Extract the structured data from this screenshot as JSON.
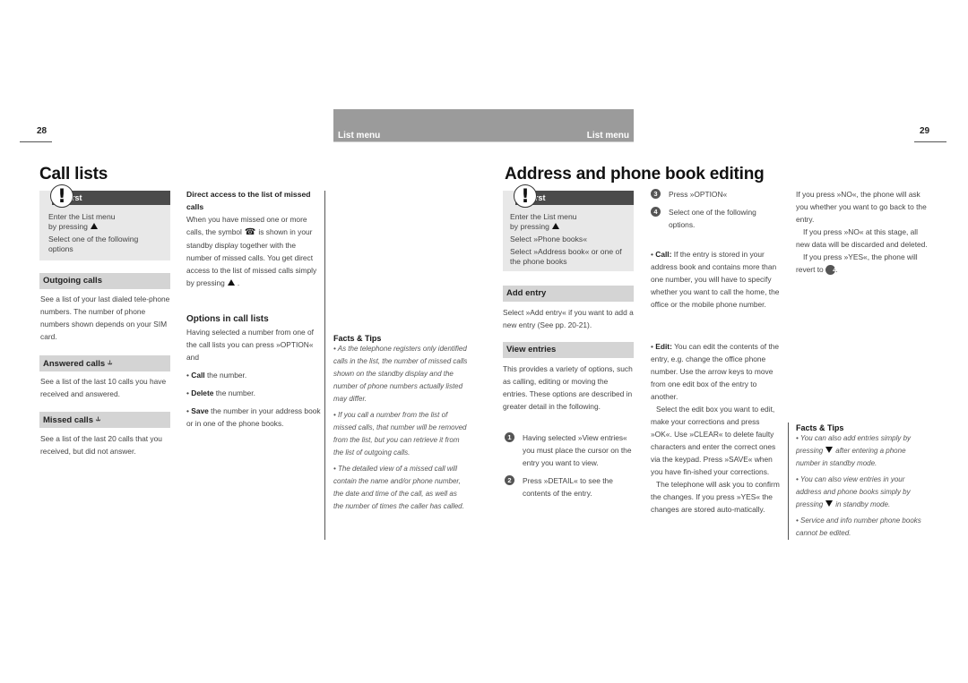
{
  "header": {
    "left_page_number": "28",
    "right_page_number": "29",
    "left_section_label": "List menu",
    "right_section_label": "List menu"
  },
  "left_page": {
    "title": "Call lists",
    "first_box": {
      "label": "First",
      "line1": "Enter the List menu",
      "line2": "by pressing",
      "line3": "Select one of the following options"
    },
    "outgoing": {
      "heading": "Outgoing calls",
      "text": "See a list of your last dialed tele-phone numbers. The number of phone numbers shown depends on your SIM card."
    },
    "answered": {
      "heading": "Answered calls",
      "text": "See a list of the last 10 calls you have received and answered."
    },
    "missed": {
      "heading": "Missed calls",
      "text": "See a list of the last 20 calls that you received, but did not answer."
    },
    "direct_access": {
      "heading": "Direct access to the list of missed calls",
      "text_before_symbol": "When you have missed one or more calls, the symbol",
      "text_after_symbol": "is shown in your standby display together with the number of missed calls. You get direct access to the list of missed calls simply by pressing"
    },
    "options": {
      "heading": "Options in call lists",
      "intro": "Having selected a number from one of the call lists you can press »OPTION« and",
      "items": [
        {
          "bold": "Call",
          "rest": "the number."
        },
        {
          "bold": "Delete",
          "rest": "the number."
        },
        {
          "bold": "Save",
          "rest": "the number in your address book or in one of the phone books."
        }
      ]
    },
    "tips": {
      "heading": "Facts & Tips",
      "items": [
        "• As the telephone registers only identified calls in the list, the number of missed calls shown on the standby display and the number of phone numbers actually listed may differ.",
        "• If you call a number from the list of missed calls, that number will be removed from the list, but you can retrieve it from the list of outgoing calls.",
        "• The detailed view of a missed call will contain the name and/or phone number, the date and time of the call, as well as the number of times the caller has called."
      ]
    }
  },
  "right_page": {
    "title": "Address and phone book editing",
    "first_box": {
      "label": "First",
      "line1": "Enter the List menu",
      "line2": "by pressing",
      "line3": "Select »Phone books«",
      "line4": "Select »Address book« or one of the phone books"
    },
    "add_entry": {
      "heading": "Add entry",
      "text": "Select »Add entry« if you want to add a new entry (See pp. 20-21)."
    },
    "view_entries": {
      "heading": "View entries",
      "text": "This provides a variety of options, such as calling, editing or moving the entries. These options are described in greater detail in the following.",
      "steps": [
        {
          "num": "1",
          "text": "Having selected »View entries« you must place the cursor on the entry you want to view."
        },
        {
          "num": "2",
          "text": "Press »DETAIL« to see the contents of the entry."
        }
      ]
    },
    "steps_col2": [
      {
        "num": "3",
        "text": "Press »OPTION«"
      },
      {
        "num": "4",
        "text": "Select one of the following options."
      }
    ],
    "call_item": {
      "bold": "Call:",
      "text": "If the entry is stored in your address book and contains more than one number, you will have to specify whether you want to call the home, the office or the mobile phone number."
    },
    "edit_item": {
      "bold": "Edit:",
      "text": "You can edit the contents of the entry, e.g. change the office phone number. Use the arrow keys to move from one edit box of the entry to another.",
      "para2": "Select the edit box you want to edit, make your corrections and press »OK«. Use »CLEAR« to delete faulty characters and enter the correct ones via the keypad. Press »SAVE« when you have fin-ished your corrections.",
      "para3": "The telephone will ask you to confirm the changes. If you press »YES« the changes are stored auto-matically."
    },
    "col3": {
      "para1": "If you press »NO«, the phone will ask you whether you want to go back to the entry.",
      "para2": "If you press »NO« at this stage, all new data will be discarded and deleted.",
      "para3": "If you press »YES«, the phone will revert to",
      "revert_num": "4"
    },
    "tips": {
      "heading": "Facts & Tips",
      "item1_before": "• You can also add entries simply by pressing",
      "item1_after": "after entering a phone number in standby mode.",
      "item2_before": "• You can also view entries in your address and phone books simply by pressing",
      "item2_after": "in standby mode.",
      "item3": "• Service and info number phone books cannot be edited."
    }
  }
}
